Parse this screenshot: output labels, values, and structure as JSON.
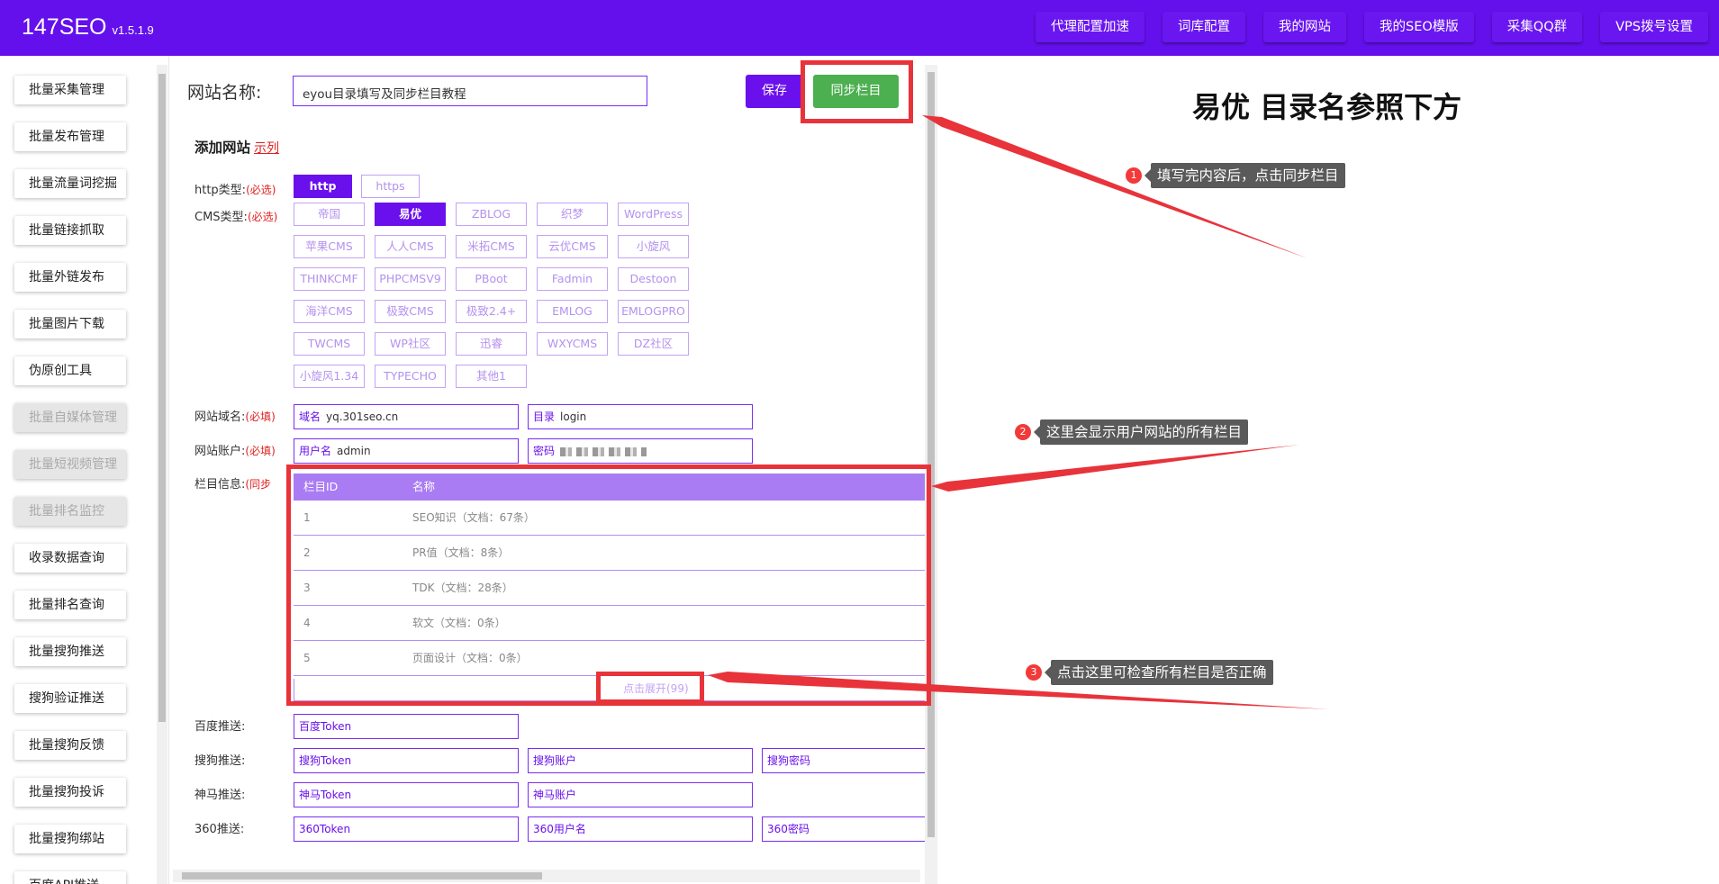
{
  "header": {
    "brand": "147SEO",
    "version": "v1.5.1.9",
    "nav": [
      "代理配置加速",
      "词库配置",
      "我的网站",
      "我的SEO模版",
      "采集QQ群",
      "VPS拨号设置"
    ]
  },
  "sidebar": {
    "items": [
      {
        "label": "批量采集管理",
        "disabled": false
      },
      {
        "label": "批量发布管理",
        "disabled": false
      },
      {
        "label": "批量流量词挖掘",
        "disabled": false
      },
      {
        "label": "批量链接抓取",
        "disabled": false
      },
      {
        "label": "批量外链发布",
        "disabled": false
      },
      {
        "label": "批量图片下载",
        "disabled": false
      },
      {
        "label": "伪原创工具",
        "disabled": false
      },
      {
        "label": "批量自媒体管理",
        "disabled": true
      },
      {
        "label": "批量短视频管理",
        "disabled": true
      },
      {
        "label": "批量排名监控",
        "disabled": true
      },
      {
        "label": "收录数据查询",
        "disabled": false
      },
      {
        "label": "批量排名查询",
        "disabled": false
      },
      {
        "label": "批量搜狗推送",
        "disabled": false
      },
      {
        "label": "搜狗验证推送",
        "disabled": false
      },
      {
        "label": "批量搜狗反馈",
        "disabled": false
      },
      {
        "label": "批量搜狗投诉",
        "disabled": false
      },
      {
        "label": "批量搜狗绑站",
        "disabled": false
      },
      {
        "label": "百度API推送",
        "disabled": false
      }
    ]
  },
  "form": {
    "site_name_label": "网站名称:",
    "site_name_value": "eyou目录填写及同步栏目教程",
    "save_label": "保存",
    "sync_label": "同步栏目",
    "section_title": "添加网站",
    "example_link": "示列",
    "http_label": "http类型:",
    "cms_label": "CMS类型:",
    "required_select": "(必选)",
    "http_options": [
      "http",
      "https"
    ],
    "http_selected": "http",
    "cms_options": [
      "帝国",
      "易优",
      "ZBLOG",
      "织梦",
      "WordPress",
      "苹果CMS",
      "人人CMS",
      "米拓CMS",
      "云优CMS",
      "小旋风",
      "THINKCMF",
      "PHPCMSV9",
      "PBoot",
      "Fadmin",
      "Destoon",
      "海洋CMS",
      "极致CMS",
      "极致2.4+",
      "EMLOG",
      "EMLOGPRO",
      "TWCMS",
      "WP社区",
      "迅睿",
      "WXYCMS",
      "DZ社区",
      "小旋风1.34",
      "TYPECHO",
      "其他1"
    ],
    "cms_selected": "易优",
    "domain_label": "网站域名:",
    "account_label": "网站账户:",
    "required_fill": "(必填)",
    "domain_prefix": "域名",
    "domain_value": "yq.301seo.cn",
    "dir_prefix": "目录",
    "dir_value": "login",
    "user_prefix": "用户名",
    "user_value": "admin",
    "pwd_prefix": "密码",
    "category_label": "栏目信息:",
    "category_hint": "(同步",
    "category_table": {
      "headers": [
        "栏目ID",
        "名称"
      ],
      "rows": [
        {
          "id": "1",
          "name": "SEO知识（文档：67条）"
        },
        {
          "id": "2",
          "name": "PR值（文档：8条）"
        },
        {
          "id": "3",
          "name": "TDK（文档：28条）"
        },
        {
          "id": "4",
          "name": "软文（文档：0条）"
        },
        {
          "id": "5",
          "name": "页面设计（文档：0条）"
        }
      ],
      "expand_label": "点击展开(99)"
    },
    "baidu_label": "百度推送:",
    "sogou_label": "搜狗推送:",
    "shenma_label": "神马推送:",
    "q360_label": "360推送:",
    "baidu_token": "百度Token",
    "sogou_token": "搜狗Token",
    "sogou_account": "搜狗账户",
    "sogou_pwd": "搜狗密码",
    "shenma_token": "神马Token",
    "shenma_account": "神马账户",
    "q360_token": "360Token",
    "q360_user": "360用户名",
    "q360_pwd": "360密码"
  },
  "annotations": {
    "title": "易优 目录名参照下方",
    "notes": [
      {
        "num": "1",
        "text": "填写完内容后，点击同步栏目"
      },
      {
        "num": "2",
        "text": "这里会显示用户网站的所有栏目"
      },
      {
        "num": "3",
        "text": "点击这里可检查所有栏目是否正确"
      }
    ],
    "highlight_color": "#e8333b"
  },
  "colors": {
    "brand_purple": "#6410ec",
    "sync_green": "#4caf50",
    "table_header": "#a97cf3",
    "required_red": "#e0201e"
  }
}
